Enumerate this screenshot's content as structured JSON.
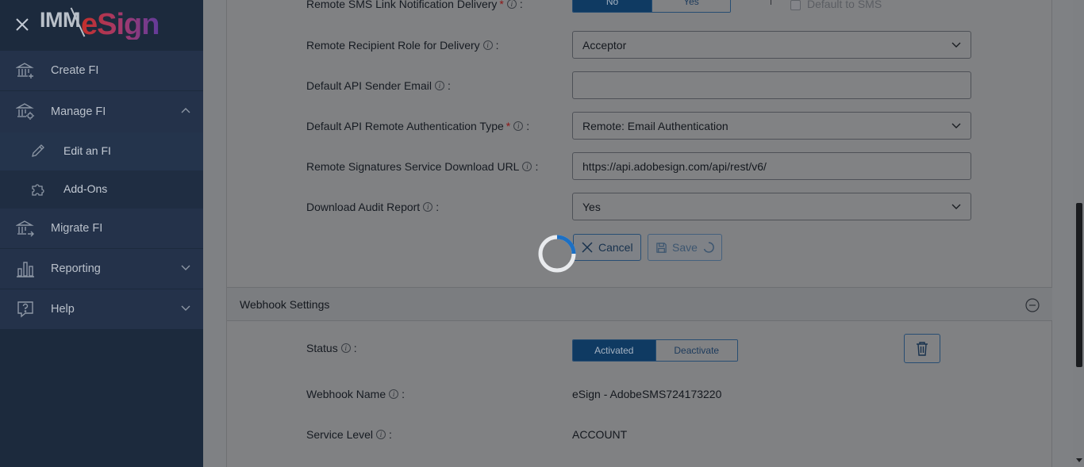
{
  "sidebar": {
    "logo": {
      "left": "IMM",
      "right": "eSign"
    },
    "items": [
      {
        "label": "Create FI"
      },
      {
        "label": "Manage FI"
      },
      {
        "label": "Edit an FI"
      },
      {
        "label": "Add-Ons"
      },
      {
        "label": "Migrate FI"
      },
      {
        "label": "Reporting"
      },
      {
        "label": "Help"
      }
    ]
  },
  "form": {
    "sms_link": {
      "label": "Remote SMS Link Notification Delivery",
      "options": [
        "No",
        "Yes"
      ],
      "selected": "No",
      "checkbox_label": "Default to SMS"
    },
    "recipient_role": {
      "label": "Remote Recipient Role for Delivery",
      "value": "Acceptor"
    },
    "api_sender_email": {
      "label": "Default API Sender Email",
      "value": ""
    },
    "auth_type": {
      "label": "Default API Remote Authentication Type",
      "value": "Remote: Email Authentication"
    },
    "download_url": {
      "label": "Remote Signatures Service Download URL",
      "value": "https://api.adobesign.com/api/rest/v6/"
    },
    "audit_report": {
      "label": "Download Audit Report",
      "value": "Yes"
    },
    "buttons": {
      "cancel": "Cancel",
      "save": "Save"
    }
  },
  "webhook": {
    "section_title": "Webhook Settings",
    "status": {
      "label": "Status",
      "options": [
        "Activated",
        "Deactivate"
      ],
      "selected": "Activated"
    },
    "name": {
      "label": "Webhook Name",
      "value": "eSign - AdobeSMS724173220"
    },
    "service_level": {
      "label": "Service Level",
      "value": "ACCOUNT"
    }
  },
  "colors": {
    "sidebar_bg": "#1c2a3d",
    "accent": "#0f3a62",
    "required": "#8e1414"
  }
}
